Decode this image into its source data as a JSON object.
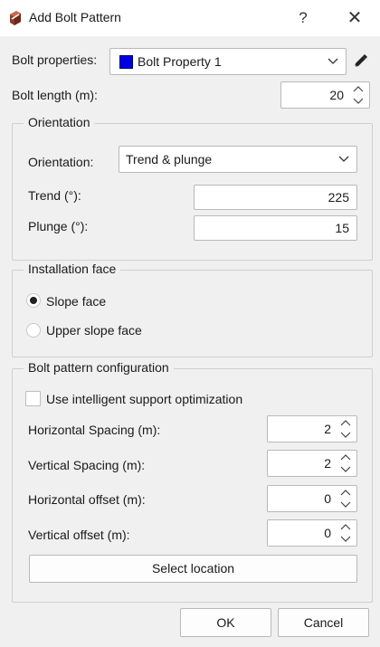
{
  "window": {
    "title": "Add Bolt Pattern",
    "help_label": "?",
    "close_label": "✕"
  },
  "bolt_properties": {
    "label": "Bolt properties:",
    "value": "Bolt Property 1",
    "swatch_color": "#0000e6"
  },
  "bolt_length": {
    "label": "Bolt length (m):",
    "value": "20"
  },
  "orientation_group": {
    "title": "Orientation",
    "orientation_label": "Orientation:",
    "orientation_value": "Trend & plunge",
    "trend_label": "Trend (°):",
    "trend_value": "225",
    "plunge_label": "Plunge (°):",
    "plunge_value": "15"
  },
  "installation_group": {
    "title": "Installation face",
    "options": [
      {
        "label": "Slope face",
        "selected": true
      },
      {
        "label": "Upper slope face",
        "selected": false
      }
    ]
  },
  "pattern_group": {
    "title": "Bolt pattern configuration",
    "optimization_label": "Use intelligent support optimization",
    "optimization_checked": false,
    "horizontal_spacing_label": "Horizontal Spacing (m):",
    "horizontal_spacing_value": "2",
    "vertical_spacing_label": "Vertical Spacing (m):",
    "vertical_spacing_value": "2",
    "horizontal_offset_label": "Horizontal offset (m):",
    "horizontal_offset_value": "0",
    "vertical_offset_label": "Vertical offset (m):",
    "vertical_offset_value": "0",
    "select_location_label": "Select location"
  },
  "footer": {
    "ok_label": "OK",
    "cancel_label": "Cancel"
  }
}
